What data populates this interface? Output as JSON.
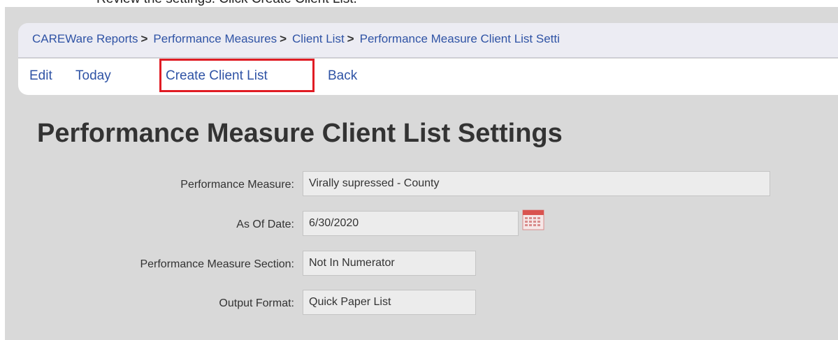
{
  "instruction": "Review the settings. Click Create Client List.",
  "breadcrumb": [
    {
      "label": "CAREWare Reports"
    },
    {
      "label": "Performance Measures"
    },
    {
      "label": "Client List"
    },
    {
      "label": "Performance Measure Client List Setti"
    }
  ],
  "breadcrumb_separator": ">",
  "menu": {
    "edit": "Edit",
    "today": "Today",
    "create_client_list": "Create Client List",
    "back": "Back"
  },
  "page_title": "Performance Measure Client List Settings",
  "fields": {
    "performance_measure": {
      "label": "Performance Measure:",
      "value": "Virally supressed - County"
    },
    "as_of_date": {
      "label": "As Of Date:",
      "value": "6/30/2020"
    },
    "section": {
      "label": "Performance Measure Section:",
      "value": "Not In Numerator"
    },
    "output_format": {
      "label": "Output Format:",
      "value": "Quick Paper List"
    }
  },
  "colors": {
    "link": "#2f53a5",
    "highlight": "#e01c24",
    "background": "#d9d9d9"
  },
  "icons": {
    "calendar": "calendar-icon"
  }
}
